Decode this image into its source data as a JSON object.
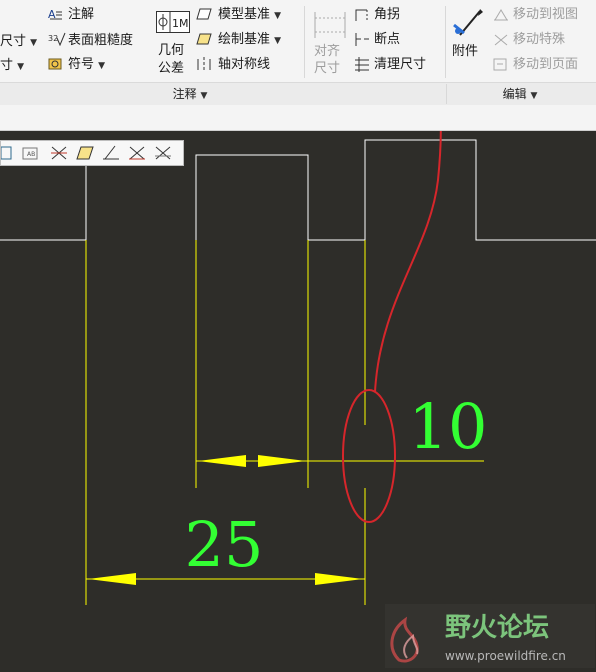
{
  "ribbon": {
    "left_partial": {
      "dim_a": "尺寸",
      "dim_b": "寸"
    },
    "annotate": {
      "note": "注解",
      "surface_finish": "表面粗糙度",
      "symbol": "符号",
      "geo_tol_line1": "几何",
      "geo_tol_line2": "公差",
      "model_datum": "模型基准",
      "draw_datum": "绘制基准",
      "axis_sym": "轴对称线",
      "align_line1": "对齐",
      "align_line2": "尺寸",
      "corner": "角拐",
      "breakpoint": "断点",
      "cleanup_dim": "清理尺寸",
      "group_label": "注释"
    },
    "edit": {
      "attach": "附件",
      "move_to_view": "移动到视图",
      "move_special": "移动特殊",
      "move_to_page": "移动到页面",
      "group_label": "编辑"
    }
  },
  "drawing": {
    "dim_25": "25",
    "dim_10": "10",
    "colors": {
      "background": "#2e2d29",
      "geometry": "#ffffff",
      "dimension": "#ffff00",
      "text": "#33ff33",
      "annotation": "#d6262b"
    }
  },
  "watermark": {
    "title": "野火论坛",
    "url": "www.proewildfire.cn"
  }
}
